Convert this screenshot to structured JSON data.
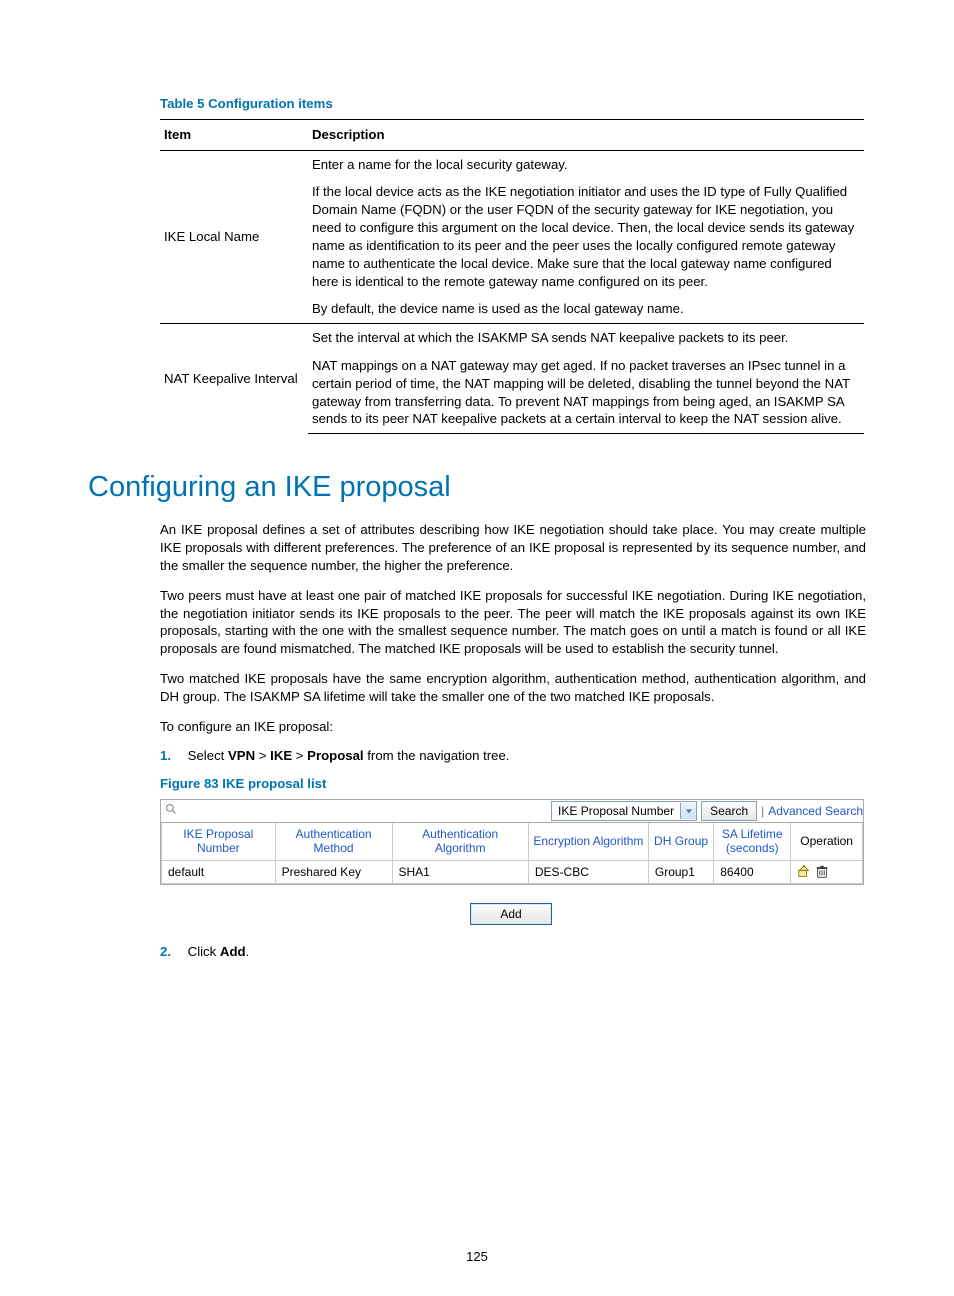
{
  "table5": {
    "title": "Table 5 Configuration items",
    "headers": {
      "item": "Item",
      "desc": "Description"
    },
    "rows": [
      {
        "item": "IKE Local Name",
        "paras": [
          "Enter a name for the local security gateway.",
          "If the local device acts as the IKE negotiation initiator and uses the ID type of Fully Qualified Domain Name (FQDN) or the user FQDN of the security gateway for IKE negotiation, you need to configure this argument on the local device. Then, the local device sends its gateway name as identification to its peer and the peer uses the locally configured remote gateway name to authenticate the local device. Make sure that the local gateway name configured here is identical to the remote gateway name configured on its peer.",
          "By default, the device name is used as the local gateway name."
        ]
      },
      {
        "item": "NAT Keepalive Interval",
        "paras": [
          "Set the interval at which the ISAKMP SA sends NAT keepalive packets to its peer.",
          "NAT mappings on a NAT gateway may get aged. If no packet traverses an IPsec tunnel in a certain period of time, the NAT mapping will be deleted, disabling the tunnel beyond the NAT gateway from transferring data. To prevent NAT mappings from being aged, an ISAKMP SA sends to its peer NAT keepalive packets at a certain interval to keep the NAT session alive."
        ]
      }
    ]
  },
  "section": {
    "heading": "Configuring an IKE proposal",
    "p1": "An IKE proposal defines a set of attributes describing how IKE negotiation should take place. You may create multiple IKE proposals with different preferences. The preference of an IKE proposal is represented by its sequence number, and the smaller the sequence number, the higher the preference.",
    "p2": "Two peers must have at least one pair of matched IKE proposals for successful IKE negotiation. During IKE negotiation, the negotiation initiator sends its IKE proposals to the peer. The peer will match the IKE proposals against its own IKE proposals, starting with the one with the smallest sequence number. The match goes on until a match is found or all IKE proposals are found mismatched. The matched IKE proposals will be used to establish the security tunnel.",
    "p3": "Two matched IKE proposals have the same encryption algorithm, authentication method, authentication algorithm, and DH group. The ISAKMP SA lifetime will take the smaller one of the two matched IKE proposals.",
    "p4": "To configure an IKE proposal:",
    "step1": {
      "num": "1.",
      "pre": "Select ",
      "vpn": "VPN",
      "gt1": " > ",
      "ike": "IKE",
      "gt2": " > ",
      "proposal": "Proposal",
      "post": " from the navigation tree."
    },
    "step2": {
      "num": "2.",
      "pre": "Click ",
      "add": "Add",
      "post": "."
    },
    "figure_title": "Figure 83 IKE proposal list"
  },
  "ike_ui": {
    "select_label": "IKE Proposal Number",
    "search_btn": "Search",
    "advanced": "Advanced Search",
    "headers": {
      "num": "IKE Proposal Number",
      "auth_method": "Authentication Method",
      "auth_algo": "Authentication Algorithm",
      "enc_algo": "Encryption Algorithm",
      "dh": "DH Group",
      "sa": "SA Lifetime (seconds)",
      "op": "Operation"
    },
    "row": {
      "num": "default",
      "auth_method": "Preshared Key",
      "auth_algo": "SHA1",
      "enc_algo": "DES-CBC",
      "dh": "Group1",
      "sa": "86400"
    },
    "add_btn": "Add"
  },
  "page_number": "125"
}
